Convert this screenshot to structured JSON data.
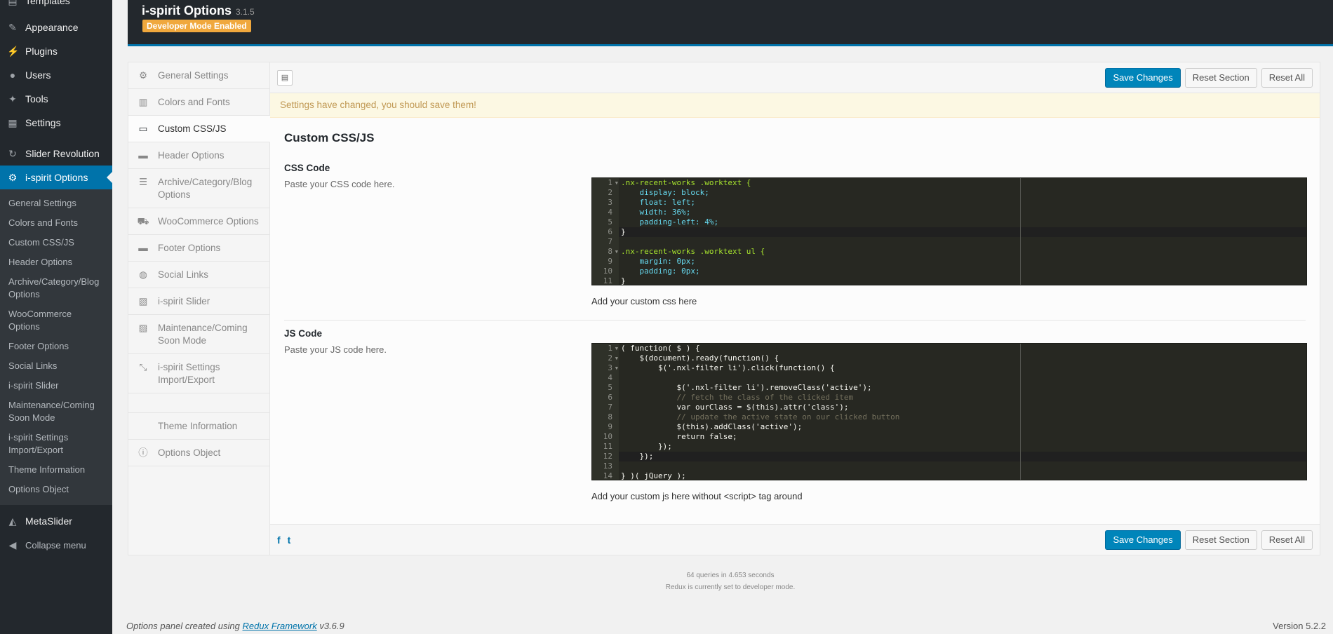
{
  "wp_menu": {
    "items": [
      {
        "label": "Templates",
        "icon": "templates-icon"
      },
      {
        "label": "Appearance",
        "icon": "paintbrush-icon"
      },
      {
        "label": "Plugins",
        "icon": "plugin-icon"
      },
      {
        "label": "Users",
        "icon": "user-icon"
      },
      {
        "label": "Tools",
        "icon": "wrench-icon"
      },
      {
        "label": "Settings",
        "icon": "settings-icon"
      },
      {
        "label": "Slider Revolution",
        "icon": "refresh-icon"
      },
      {
        "label": "i-spirit Options",
        "icon": "gear-icon"
      }
    ],
    "submenu": [
      "General Settings",
      "Colors and Fonts",
      "Custom CSS/JS",
      "Header Options",
      "Archive/Category/Blog Options",
      "WooCommerce Options",
      "Footer Options",
      "Social Links",
      "i-spirit Slider",
      "Maintenance/Coming Soon Mode",
      "i-spirit Settings Import/Export",
      "Theme Information",
      "Options Object"
    ],
    "metaslider": "MetaSlider",
    "collapse": "Collapse menu"
  },
  "header": {
    "title": "i-spirit Options",
    "version": "3.1.5",
    "badge": "Developer Mode Enabled"
  },
  "nav": {
    "items": [
      {
        "label": "General Settings",
        "icon": "cogs-icon"
      },
      {
        "label": "Colors and Fonts",
        "icon": "palette-icon"
      },
      {
        "label": "Custom CSS/JS",
        "icon": "monitor-icon"
      },
      {
        "label": "Header Options",
        "icon": "header-icon"
      },
      {
        "label": "Archive/Category/Blog Options",
        "icon": "list-icon"
      },
      {
        "label": "WooCommerce Options",
        "icon": "cart-icon"
      },
      {
        "label": "Footer Options",
        "icon": "footer-icon"
      },
      {
        "label": "Social Links",
        "icon": "globe-icon"
      },
      {
        "label": "i-spirit Slider",
        "icon": "picture-icon"
      },
      {
        "label": "Maintenance/Coming Soon Mode",
        "icon": "picture-icon"
      },
      {
        "label": "i-spirit Settings Import/Export",
        "icon": "arrows-icon"
      }
    ],
    "theme_info": "Theme Information",
    "options_object": "Options Object"
  },
  "actions": {
    "save": "Save Changes",
    "reset_section": "Reset Section",
    "reset_all": "Reset All"
  },
  "notice": "Settings have changed, you should save them!",
  "section": {
    "title": "Custom CSS/JS",
    "css": {
      "title": "CSS Code",
      "desc": "Paste your CSS code here.",
      "sub": "Add your custom css here"
    },
    "js": {
      "title": "JS Code",
      "desc": "Paste your JS code here.",
      "sub": "Add your custom js here without <script> tag around"
    }
  },
  "css_code": [
    ".nx-recent-works .worktext {",
    "    display: block;",
    "    float: left;",
    "    width: 36%;",
    "    padding-left: 4%;",
    "}",
    "",
    ".nx-recent-works .worktext ul {",
    "    margin: 0px;",
    "    padding: 0px;",
    "}"
  ],
  "js_code": [
    "( function( $ ) {",
    "    $(document).ready(function() {",
    "        $('.nxl-filter li').click(function() {",
    "",
    "            $('.nxl-filter li').removeClass('active');",
    "            // fetch the class of the clicked item",
    "            var ourClass = $(this).attr('class');",
    "            // update the active state on our clicked button",
    "            $(this).addClass('active');",
    "            return false;",
    "        });",
    "    });",
    "",
    "} )( jQuery );"
  ],
  "stats": {
    "queries": "64 queries in 4.653 seconds",
    "devmode": "Redux is currently set to developer mode."
  },
  "footer": {
    "credit_prefix": "Options panel created using",
    "credit_link": "Redux Framework",
    "credit_version": "v3.6.9",
    "wp_version": "Version 5.2.2"
  }
}
